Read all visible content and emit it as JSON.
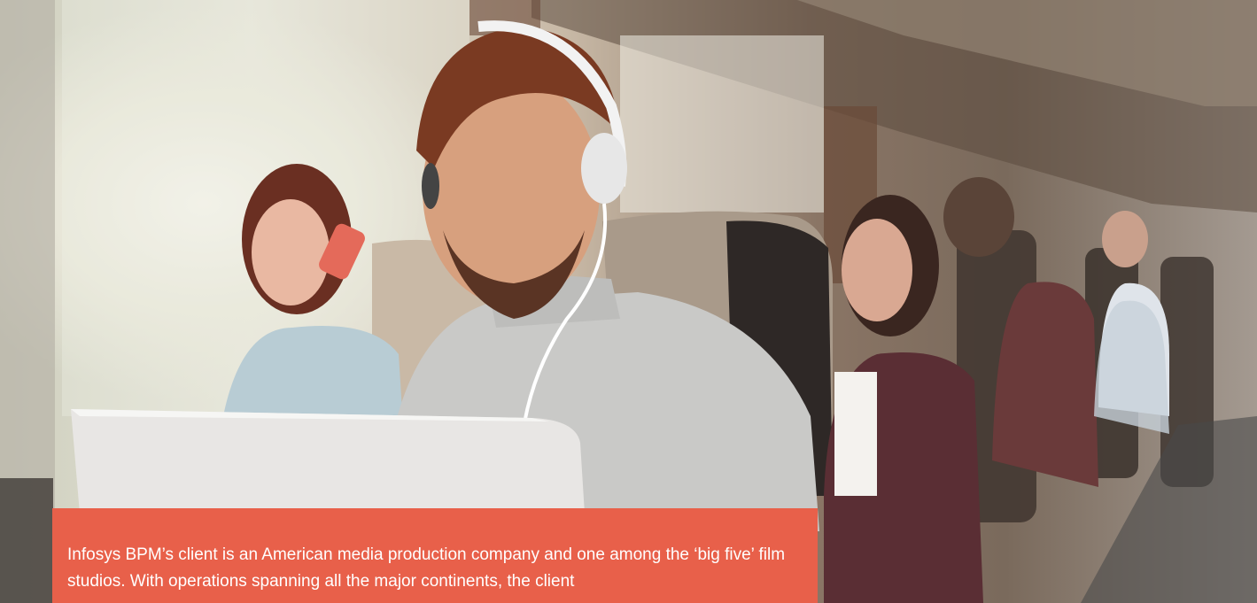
{
  "hero": {
    "caption": "Infosys BPM’s client is an American media production company and one among the ‘big five’ film studios. With operations spanning all the major continents, the client"
  },
  "colors": {
    "caption_background": "#e8604a",
    "caption_text": "#ffffff"
  }
}
